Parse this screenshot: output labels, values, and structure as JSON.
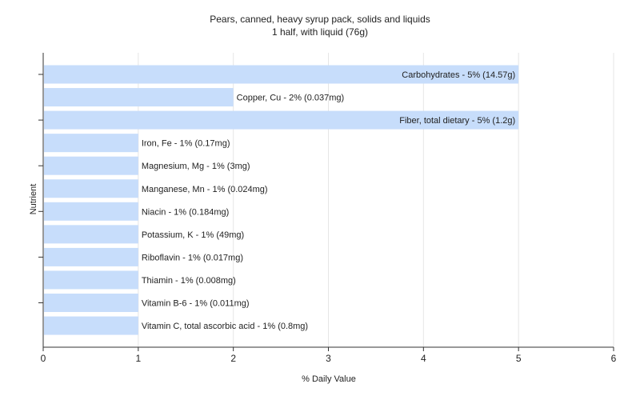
{
  "chart_data": {
    "type": "bar",
    "orientation": "horizontal",
    "title": "Pears, canned, heavy syrup pack, solids and liquids",
    "subtitle": "1 half, with liquid (76g)",
    "xlabel": "% Daily Value",
    "ylabel": "Nutrient",
    "xlim": [
      0,
      6
    ],
    "xticks": [
      "0",
      "1",
      "2",
      "3",
      "4",
      "5",
      "6"
    ],
    "grid": true,
    "bar_color": "#c7ddfb",
    "categories": [
      "Carbohydrates",
      "Copper, Cu",
      "Fiber, total dietary",
      "Iron, Fe",
      "Magnesium, Mg",
      "Manganese, Mn",
      "Niacin",
      "Potassium, K",
      "Riboflavin",
      "Thiamin",
      "Vitamin B-6",
      "Vitamin C, total ascorbic acid"
    ],
    "values": [
      5,
      2,
      5,
      1,
      1,
      1,
      1,
      1,
      1,
      1,
      1,
      1
    ],
    "labels": [
      "Carbohydrates - 5% (14.57g)",
      "Copper, Cu - 2% (0.037mg)",
      "Fiber, total dietary - 5% (1.2g)",
      "Iron, Fe - 1% (0.17mg)",
      "Magnesium, Mg - 1% (3mg)",
      "Manganese, Mn - 1% (0.024mg)",
      "Niacin - 1% (0.184mg)",
      "Potassium, K - 1% (49mg)",
      "Riboflavin - 1% (0.017mg)",
      "Thiamin - 1% (0.008mg)",
      "Vitamin B-6 - 1% (0.011mg)",
      "Vitamin C, total ascorbic acid - 1% (0.8mg)"
    ]
  }
}
